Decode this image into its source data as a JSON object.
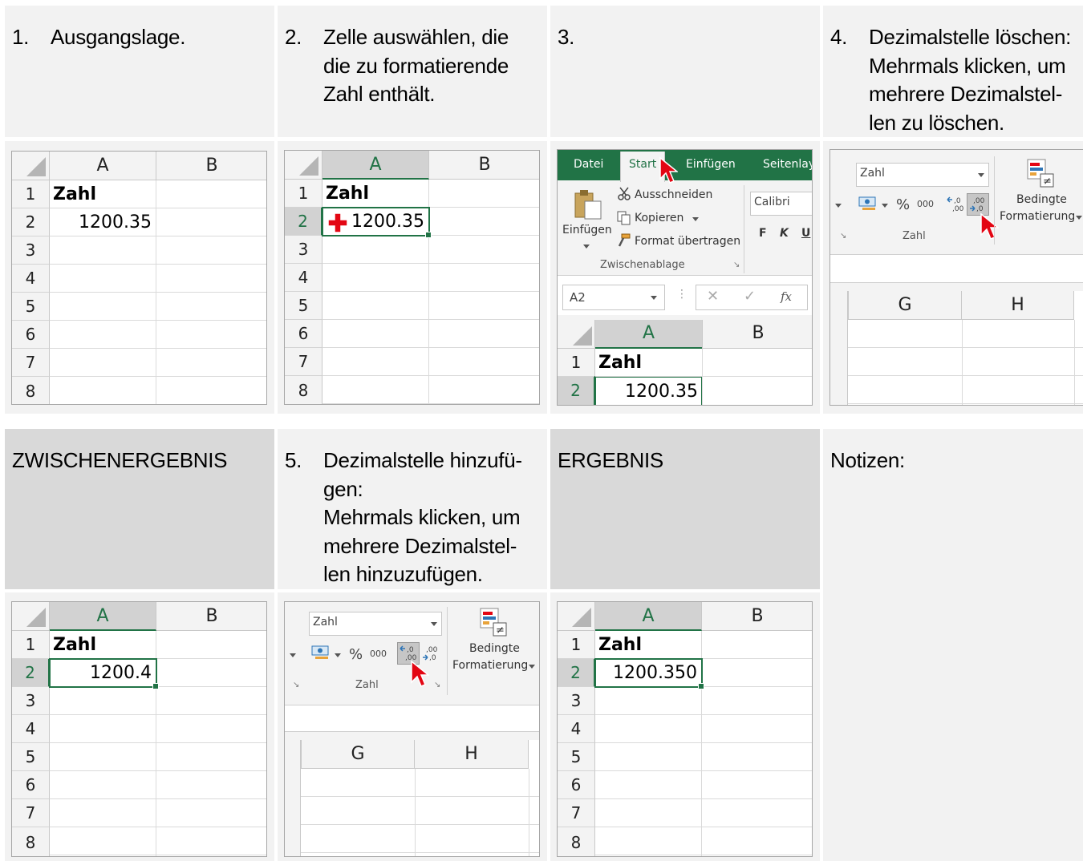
{
  "steps": {
    "s1": {
      "num": "1.",
      "text": [
        "Ausgangslage."
      ]
    },
    "s2": {
      "num": "2.",
      "text": [
        "Zelle auswählen, die",
        "die zu formatierende",
        "Zahl enthält."
      ]
    },
    "s3": {
      "num": "3.",
      "text": []
    },
    "s4": {
      "num": "4.",
      "text": [
        "Dezimalstelle löschen:",
        "Mehrmals klicken, um",
        "mehrere Dezimalstel-",
        "len zu löschen."
      ]
    },
    "interim": "ZWISCHENERGEBNIS",
    "s5": {
      "num": "5.",
      "text": [
        "Dezimalstelle hinzufü-",
        "gen:",
        "Mehrmals klicken, um",
        "mehrere Dezimalstel-",
        "len hinzuzufügen."
      ]
    },
    "result": "ERGEBNIS",
    "notes": "Notizen:"
  },
  "grid": {
    "col_a": "A",
    "col_b": "B",
    "col_g": "G",
    "col_h": "H",
    "rows": [
      "1",
      "2",
      "3",
      "4",
      "5",
      "6",
      "7",
      "8"
    ],
    "header_cell": "Zahl",
    "v1": "1200.35",
    "v2": "1200.35",
    "v3": "1200.35",
    "v_interim": "1200.4",
    "v_result": "1200.350"
  },
  "ribbon": {
    "tabs": [
      "Datei",
      "Start",
      "Einfügen",
      "Seitenlay"
    ],
    "cut": "Ausschneiden",
    "copy": "Kopieren",
    "format_painter": "Format übertragen",
    "paste": "Einfügen",
    "clipboard_group": "Zwischenablage",
    "font": "Calibri",
    "bold": "F",
    "italic": "K",
    "underline": "U",
    "name_box": "A2",
    "fx": "fx",
    "number_format": "Zahl",
    "percent": "%",
    "thousands": "000",
    "cond_1": "Bedingte",
    "cond_2": "Formatierung",
    "number_group": "Zahl"
  },
  "colors": {
    "excel_green": "#217346",
    "header_bg": "#f2f2f2",
    "header_dark": "#d9d9d9",
    "cursor_red": "#e30613"
  }
}
